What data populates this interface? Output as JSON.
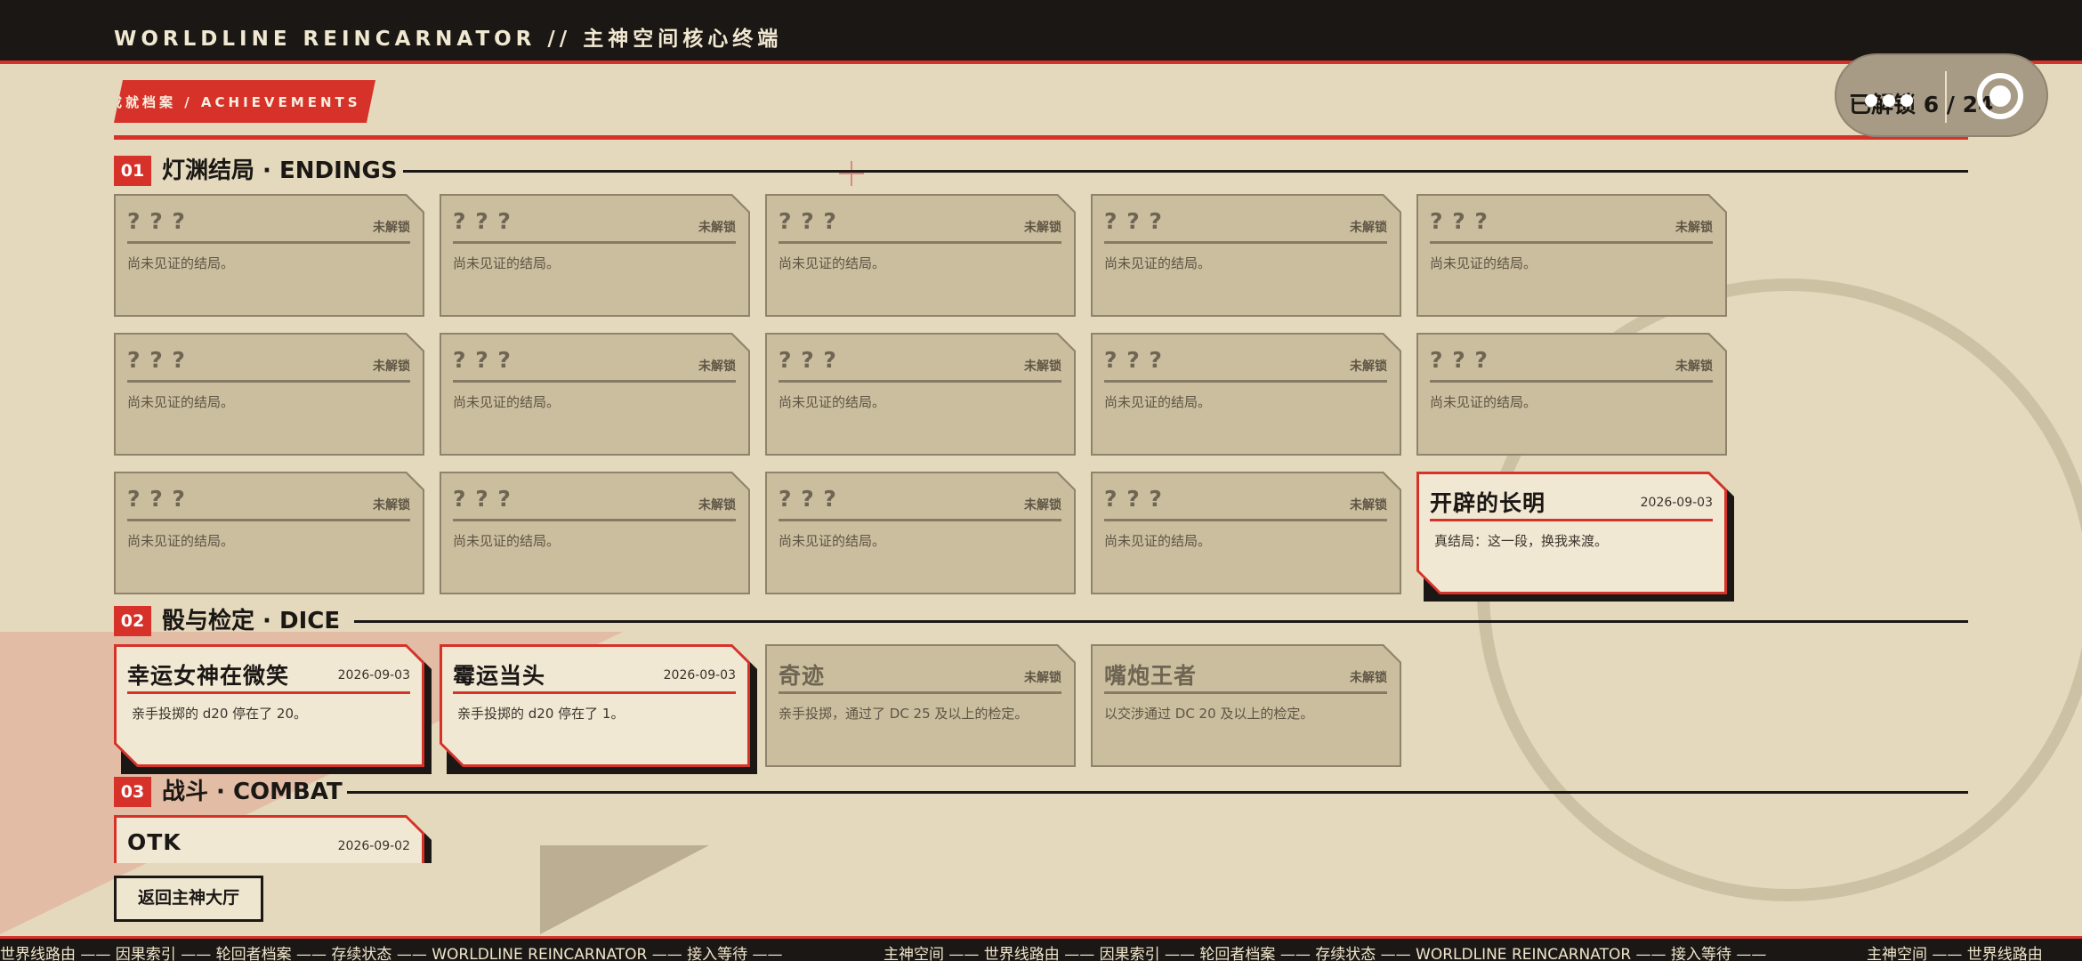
{
  "header": {
    "title": "WORLDLINE REINCARNATOR // 主神空间核心终端"
  },
  "counter": {
    "label": "已解锁 6 / 24",
    "unlocked": 6,
    "total": 24,
    "icon": "target-icon"
  },
  "section_tag": "成就档案 / ACHIEVEMENTS",
  "categories": {
    "endings": {
      "num": "01",
      "title": "灯渊结局 · ENDINGS"
    },
    "dice": {
      "num": "02",
      "title": "骰与检定 · DICE"
    },
    "combat": {
      "num": "03",
      "title": "战斗 · COMBAT"
    }
  },
  "locked": {
    "title": "? ? ?",
    "status": "未解锁",
    "desc": "尚未见证的结局。"
  },
  "endings_unlocked": {
    "title": "开辟的长明",
    "date": "2026-09-03",
    "desc": "真结局：这一段，换我来渡。"
  },
  "dice_cards": [
    {
      "title": "幸运女神在微笑",
      "status": "2026-09-03",
      "desc": "亲手投掷的 d20 停在了 20。",
      "unlocked": true
    },
    {
      "title": "霉运当头",
      "status": "2026-09-03",
      "desc": "亲手投掷的 d20 停在了 1。",
      "unlocked": true
    },
    {
      "title": "奇迹",
      "status": "未解锁",
      "desc": "亲手投掷，通过了 DC 25 及以上的检定。",
      "unlocked": false
    },
    {
      "title": "嘴炮王者",
      "status": "未解锁",
      "desc": "以交涉通过 DC 20 及以上的检定。",
      "unlocked": false
    }
  ],
  "combat_cards": [
    {
      "title": "OTK",
      "status": "2026-09-02",
      "unlocked": true
    }
  ],
  "return_button": "返回主神大厅",
  "ticker": {
    "segment_a": "世界线路由 —— 因果索引 —— 轮回者档案 —— 存续状态 —— WORLDLINE REINCARNATOR —— 接入等待 ——",
    "segment_b": "主神空间 —— 世界线路由 —— 因果索引 —— 轮回者档案 —— 存续状态 —— WORLDLINE REINCARNATOR —— 接入等待 ——",
    "segment_c": "主神空间 —— 世界线路由"
  },
  "colors": {
    "accent": "#d6322a",
    "background": "#e4d9bc",
    "dark": "#1b1714",
    "locked_card": "#cbbe9f",
    "unlocked_card": "#f1e8d4"
  }
}
